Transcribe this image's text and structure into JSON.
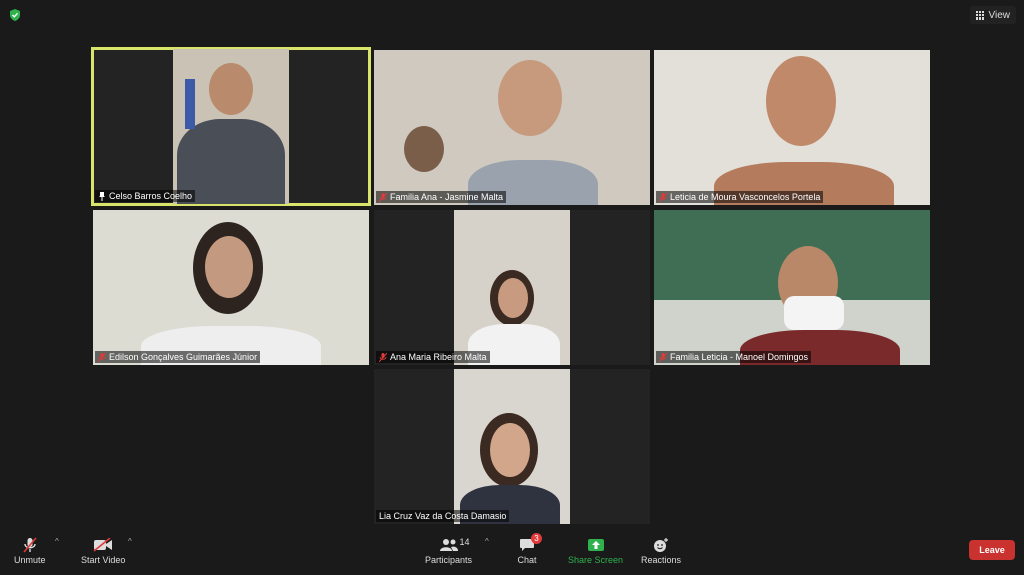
{
  "topbar": {
    "security_icon": "shield-check-icon",
    "view_label": "View"
  },
  "participants_tiles": [
    {
      "name": "Celso Barros Coelho",
      "status": "pinned",
      "active_speaker": true
    },
    {
      "name": "Familia Ana - Jasmine Malta",
      "status": "muted"
    },
    {
      "name": "Leticia de Moura Vasconcelos Portela",
      "status": "muted"
    },
    {
      "name": "Edilson Gonçalves Guimarães Júnior",
      "status": "muted"
    },
    {
      "name": "Ana Maria Ribeiro Malta",
      "status": "muted"
    },
    {
      "name": "Familia Leticia - Manoel Domingos",
      "status": "muted"
    },
    {
      "name": "Lia Cruz Vaz da Costa Damasio",
      "status": "none"
    }
  ],
  "toolbar": {
    "unmute_label": "Unmute",
    "start_video_label": "Start Video",
    "participants_label": "Participants",
    "participants_count": "14",
    "chat_label": "Chat",
    "chat_badge": "3",
    "share_screen_label": "Share Screen",
    "reactions_label": "Reactions",
    "leave_label": "Leave"
  },
  "colors": {
    "active_speaker_border": "#d8e46a",
    "share_screen": "#2fb24d",
    "leave": "#c9322f",
    "muted_icon": "#e03a3a"
  }
}
